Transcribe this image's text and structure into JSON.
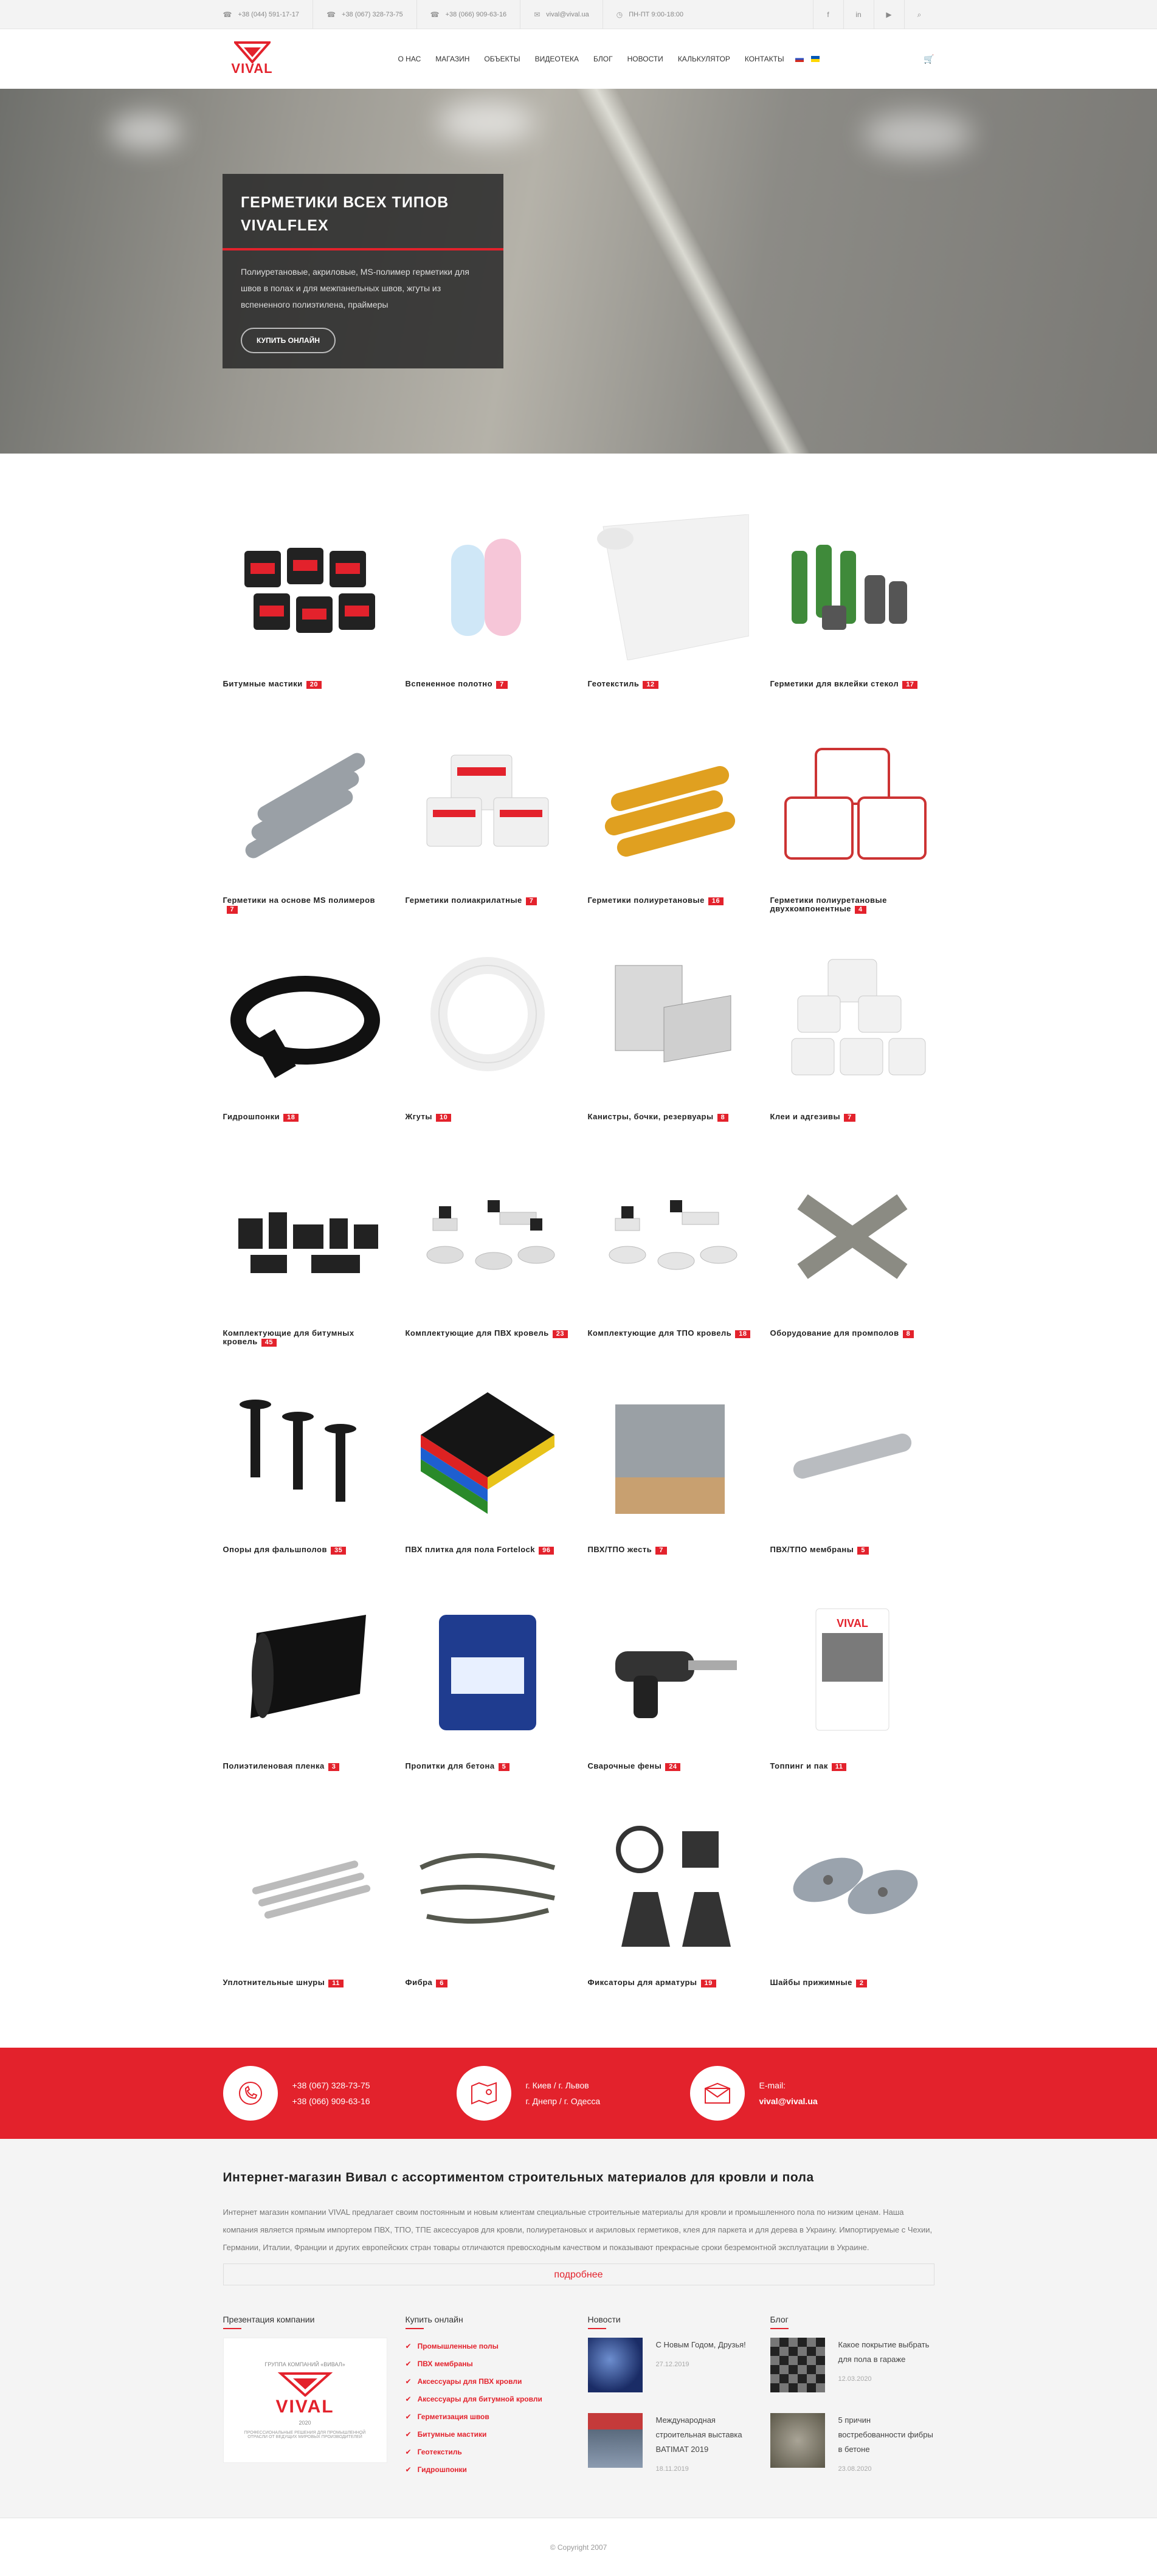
{
  "topbar": {
    "phones": [
      "+38 (044) 591-17-17",
      "+38 (067) 328-73-75",
      "+38 (066) 909-63-16"
    ],
    "email": "vival@vival.ua",
    "hours": "ПН-ПТ 9:00-18:00"
  },
  "logo": {
    "text": "VIVAL"
  },
  "nav": [
    "О НАС",
    "МАГАЗИН",
    "ОБЪЕКТЫ",
    "ВИДЕОТЕКА",
    "БЛОГ",
    "НОВОСТИ",
    "КАЛЬКУЛЯТОР",
    "КОНТАКТЫ"
  ],
  "hero": {
    "title": "Герметики всех типов VIVALFLEX",
    "text": "Полиуретановые, акриловые, MS-полимер герметики для швов в полах и для межпанельных швов, жгуты из вспененного полиэтилена, праймеры",
    "button": "купить онлайн"
  },
  "categories": [
    {
      "label": "Битумные мастики",
      "count": "20"
    },
    {
      "label": "Вспененное полотно",
      "count": "7"
    },
    {
      "label": "Геотекстиль",
      "count": "12"
    },
    {
      "label": "Герметики для вклейки стекол",
      "count": "17"
    },
    {
      "label": "Герметики на основе MS полимеров",
      "count": "7"
    },
    {
      "label": "Герметики полиакрилатные",
      "count": "7"
    },
    {
      "label": "Герметики полиуретановые",
      "count": "16"
    },
    {
      "label": "Герметики полиуретановые двухкомпонентные",
      "count": "4"
    },
    {
      "label": "Гидрошпонки",
      "count": "18"
    },
    {
      "label": "Жгуты",
      "count": "10"
    },
    {
      "label": "Канистры, бочки, резервуары",
      "count": "8"
    },
    {
      "label": "Клеи и адгезивы",
      "count": "7"
    },
    {
      "label": "Комплектующие для битумных кровель",
      "count": "45"
    },
    {
      "label": "Комплектующие для ПВХ кровель",
      "count": "23"
    },
    {
      "label": "Комплектующие для ТПО кровель",
      "count": "18"
    },
    {
      "label": "Оборудование для промполов",
      "count": "8"
    },
    {
      "label": "Опоры для фальшполов",
      "count": "35"
    },
    {
      "label": "ПВХ плитка для пола Fortelock",
      "count": "96"
    },
    {
      "label": "ПВХ/ТПО жесть",
      "count": "7"
    },
    {
      "label": "ПВХ/ТПО мембраны",
      "count": "5"
    },
    {
      "label": "Полиэтиленовая пленка",
      "count": "3"
    },
    {
      "label": "Пропитки для бетона",
      "count": "5"
    },
    {
      "label": "Сварочные фены",
      "count": "24"
    },
    {
      "label": "Топпинг и пак",
      "count": "11"
    },
    {
      "label": "Уплотнительные шнуры",
      "count": "11"
    },
    {
      "label": "Фибра",
      "count": "6"
    },
    {
      "label": "Фиксаторы для арматуры",
      "count": "19"
    },
    {
      "label": "Шайбы прижимные",
      "count": "2"
    }
  ],
  "contacts": {
    "phone1": "+38 (067) 328-73-75",
    "phone2": "+38 (066) 909-63-16",
    "city1": "г. Киев / г. Львов",
    "city2": "г. Днепр / г. Одесса",
    "email_label": "E-mail:",
    "email": "vival@vival.ua"
  },
  "about": {
    "title": "Интернет-магазин Вивал с ассортиментом строительных материалов для кровли и пола",
    "text": "Интернет магазин компании VIVAL предлагает своим постоянным и новым клиентам специальные строительные материалы для кровли и промышленного пола по низким ценам. Наша компания является прямым импортером ПВХ, ТПО, ТПЕ аксессуаров для кровли, полиуретановых и акриловых герметиков, клея для паркета и для дерева в Украину. Импортируемые с Чехии, Германии, Италии, Франции и других европейских стран товары отличаются превосходным качеством и показывают прекрасные сроки безремонтной эксплуатации в Украине.",
    "more": "подробнее"
  },
  "footer_cols": {
    "presentation_title": "Презентация компании",
    "buy_title": "Купить онлайн",
    "news_title": "Новости",
    "blog_title": "Блог",
    "presentation_caption": "ГРУППА КОМПАНИЙ «ВИВАЛ»",
    "presentation_year": "2020",
    "presentation_sub": "ПРОФЕССИОНАЛЬНЫЕ РЕШЕНИЯ ДЛЯ ПРОМЫШЛЕННОЙ ОТРАСЛИ ОТ ВЕДУЩИХ МИРОВЫХ ПРОИЗВОДИТЕЛЕЙ"
  },
  "buy_list": [
    "Промышленные полы",
    "ПВХ мембраны",
    "Аксессуары для ПВХ кровли",
    "Аксессуары для битумной кровли",
    "Герметизация швов",
    "Битумные мастики",
    "Геотекстиль",
    "Гидрошпонки"
  ],
  "news": [
    {
      "title": "С Новым Годом, Друзья!",
      "date": "27.12.2019"
    },
    {
      "title": "Международная строительная выставка BATIMAT 2019",
      "date": "18.11.2019"
    }
  ],
  "blog": [
    {
      "title": "Какое покрытие выбрать для пола в гараже",
      "date": "12.03.2020"
    },
    {
      "title": "5 причин востребованности фибры в бетоне",
      "date": "23.08.2020"
    }
  ],
  "copyright": "© Copyright 2007"
}
